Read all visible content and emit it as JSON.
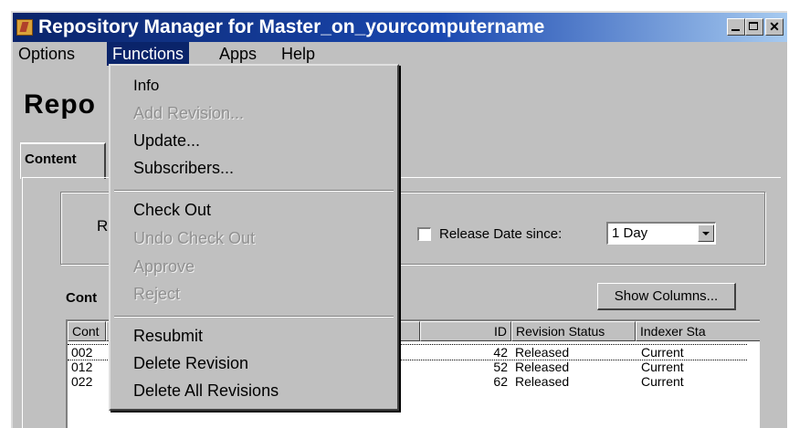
{
  "window": {
    "title": "Repository Manager for Master_on_yourcomputername"
  },
  "menubar": {
    "options": "Options",
    "functions": "Functions",
    "apps": "Apps",
    "help": "Help"
  },
  "page": {
    "title": "Repo"
  },
  "tabs": {
    "content": "Content"
  },
  "filter": {
    "checkbox_glyph": "R",
    "release_date_label": "Release Date since:",
    "release_date_value": "1 Day"
  },
  "content_label": "Cont",
  "show_columns_label": "Show Columns...",
  "table": {
    "headers": {
      "content_id": "Cont",
      "id": "ID",
      "revision_status": "Revision Status",
      "indexer_status": "Indexer Sta"
    },
    "rows": [
      {
        "content_id": "002",
        "id": "42",
        "revision_status": "Released",
        "indexer_status": "Current"
      },
      {
        "content_id": "012",
        "id": "52",
        "revision_status": "Released",
        "indexer_status": "Current"
      },
      {
        "content_id": "022",
        "id": "62",
        "revision_status": "Released",
        "indexer_status": "Current"
      }
    ]
  },
  "functions_menu": {
    "info": "Info",
    "add_revision": "Add Revision...",
    "update": "Update...",
    "subscribers": "Subscribers...",
    "check_out": "Check Out",
    "undo_check_out": "Undo Check Out",
    "approve": "Approve",
    "reject": "Reject",
    "resubmit": "Resubmit",
    "delete_revision": "Delete Revision",
    "delete_all_revisions": "Delete All Revisions"
  },
  "colors": {
    "title_bar": "#0a246a",
    "menu_highlight": "#0a246a",
    "face": "#c0c0c0"
  },
  "icons": {
    "app": "repository-app-icon",
    "minimize": "minimize-icon",
    "maximize": "maximize-icon",
    "close": "close-icon"
  }
}
